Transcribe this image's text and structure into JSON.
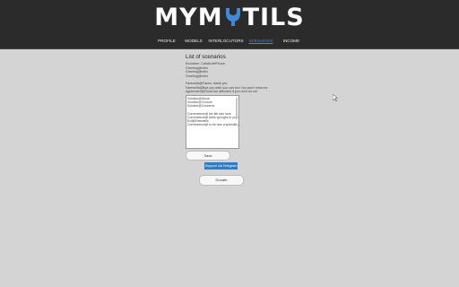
{
  "brand": {
    "logo_text_left": "MYM",
    "logo_text_right": "TILS"
  },
  "nav": {
    "items": [
      {
        "label": "PROFILE",
        "active": false
      },
      {
        "label": "MODELS",
        "active": false
      },
      {
        "label": "INTERLOCUTORS",
        "active": false
      },
      {
        "label": "SCENARIOS",
        "active": true
      },
      {
        "label": "INCOME",
        "active": false
      }
    ]
  },
  "main": {
    "title": "List of scenarios",
    "info_lines": [
      "Exclusive: Català defPhone",
      "Greeting@hello",
      "Greeting@hello",
      "Greeting@hello"
    ],
    "info_lines2": [
      "Farewells@Farew. thank you",
      "Farewells@Bye you wish you can too! You won't miss me",
      "Agreement@Good but attended if you don't do me"
    ],
    "scenario_lines": [
      "Solution@About",
      "Solution@Contour",
      "Solution@Concerns",
      "",
      "Convenience@ the life size sure",
      "Convenience@ Adds sponges to your pad ?",
      "Exit@Farewells",
      "Convenience@ to be new a splendid psych."
    ],
    "save_label": "Save",
    "telegram_label": "Support via Telegram",
    "donate_label": "Donate"
  },
  "colors": {
    "header_bg": "#2b2b2b",
    "page_bg": "#d4d4d4",
    "accent": "#2f7bc4",
    "nav_active": "#3d8bd8"
  }
}
